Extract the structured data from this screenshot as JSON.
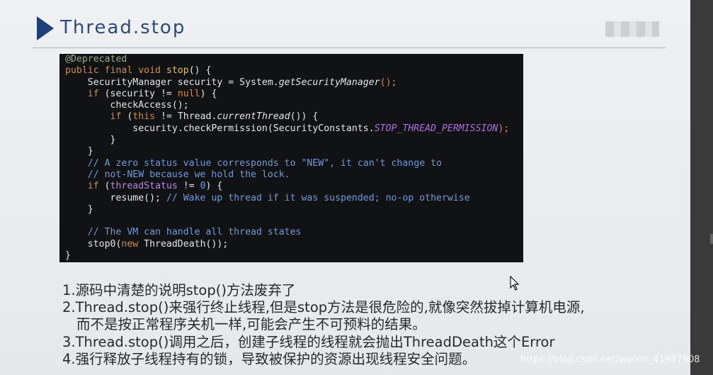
{
  "slide": {
    "title": "Thread.stop",
    "code_lines": [
      [
        {
          "t": "@Deprecated",
          "c": "ann"
        }
      ],
      [
        {
          "t": "public final void ",
          "c": "kw"
        },
        {
          "t": "stop",
          "c": "fn"
        },
        {
          "t": "() {",
          "c": ""
        }
      ],
      [
        {
          "t": "    SecurityManager security = System.",
          "c": ""
        },
        {
          "t": "getSecurityManager",
          "c": "it"
        },
        {
          "t": "();",
          "c": "kw"
        }
      ],
      [
        {
          "t": "    ",
          "c": ""
        },
        {
          "t": "if",
          "c": "kw"
        },
        {
          "t": " (security != ",
          "c": ""
        },
        {
          "t": "null",
          "c": "kw"
        },
        {
          "t": ") {",
          "c": ""
        }
      ],
      [
        {
          "t": "        checkAccess();",
          "c": ""
        }
      ],
      [
        {
          "t": "        ",
          "c": ""
        },
        {
          "t": "if",
          "c": "kw"
        },
        {
          "t": " (",
          "c": ""
        },
        {
          "t": "this",
          "c": "kw"
        },
        {
          "t": " != Thread.",
          "c": ""
        },
        {
          "t": "currentThread",
          "c": "it"
        },
        {
          "t": "()) {",
          "c": ""
        }
      ],
      [
        {
          "t": "            security.checkPermission(SecurityConstants.",
          "c": ""
        },
        {
          "t": "STOP_THREAD_PERMISSION",
          "c": "const"
        },
        {
          "t": ");",
          "c": "kw"
        }
      ],
      [
        {
          "t": "        }",
          "c": ""
        }
      ],
      [
        {
          "t": "    }",
          "c": ""
        }
      ],
      [
        {
          "t": "    // A zero status value corresponds to \"NEW\", it can't change to",
          "c": "cm"
        }
      ],
      [
        {
          "t": "    // not-NEW because we hold the lock.",
          "c": "cm"
        }
      ],
      [
        {
          "t": "    ",
          "c": ""
        },
        {
          "t": "if",
          "c": "kw"
        },
        {
          "t": " (",
          "c": ""
        },
        {
          "t": "threadStatus",
          "c": "purple"
        },
        {
          "t": " != ",
          "c": ""
        },
        {
          "t": "0",
          "c": "num"
        },
        {
          "t": ") {",
          "c": ""
        }
      ],
      [
        {
          "t": "        resume(); ",
          "c": ""
        },
        {
          "t": "// Wake up thread if it was suspended; no-op otherwise",
          "c": "cm"
        }
      ],
      [
        {
          "t": "    }",
          "c": ""
        }
      ],
      [
        {
          "t": "",
          "c": ""
        }
      ],
      [
        {
          "t": "    // The VM can handle all thread states",
          "c": "cm"
        }
      ],
      [
        {
          "t": "    stop0(",
          "c": ""
        },
        {
          "t": "new",
          "c": "kw"
        },
        {
          "t": " ThreadDeath());",
          "c": ""
        }
      ],
      [
        {
          "t": "}",
          "c": ""
        }
      ]
    ],
    "bullets": [
      {
        "text": "1.源码中清楚的说明stop()方法废弃了",
        "indent": false
      },
      {
        "text": "2.Thread.stop()来强行终止线程,但是stop方法是很危险的,就像突然拔掉计算机电源,",
        "indent": false
      },
      {
        "text": "而不是按正常程序关机一样,可能会产生不可预料的结果。",
        "indent": true
      },
      {
        "text": "3.Thread.stop()调用之后，创建子线程的线程就会抛出ThreadDeath这个Error",
        "indent": false
      },
      {
        "text": "4.强行释放子线程持有的锁，导致被保护的资源出现线程安全问题。",
        "indent": false
      }
    ]
  },
  "watermark": "https://blog.csdn.net/weixin_41987908",
  "colors": {
    "title": "#2a4b7f",
    "arrow": "#1f3f78",
    "code_bg": "#111214"
  },
  "icons": {
    "title_marker": "triangle-right-icon",
    "cursor": "mouse-pointer-icon"
  }
}
